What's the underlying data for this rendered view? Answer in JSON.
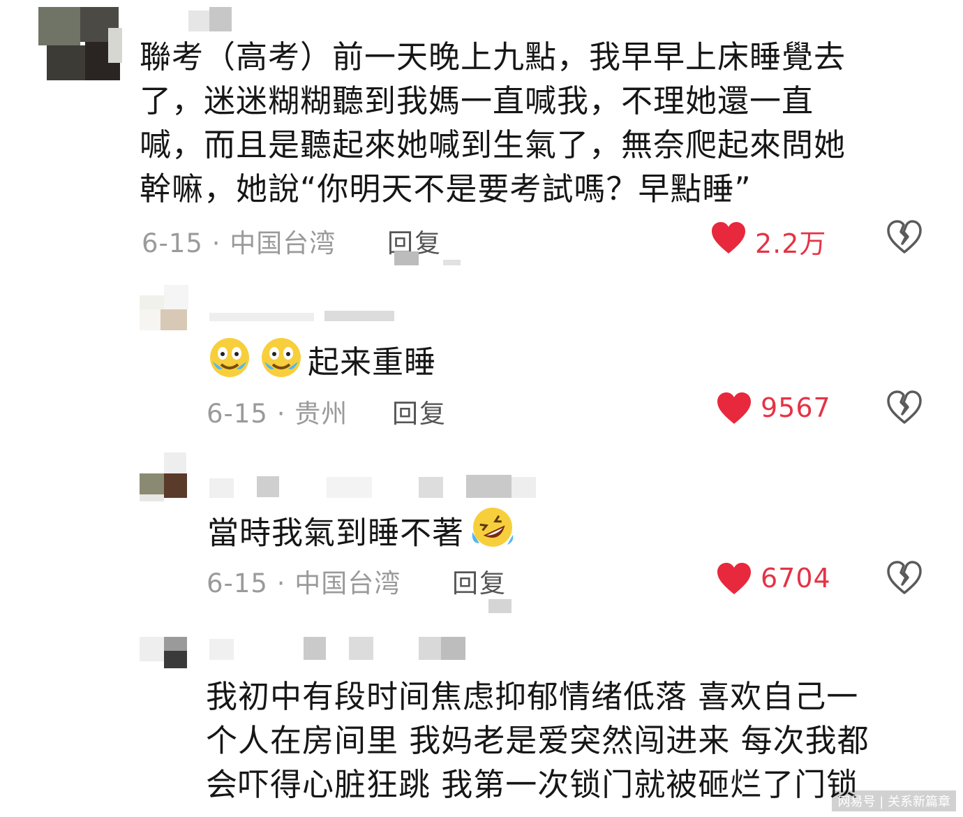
{
  "comments": [
    {
      "text_lines": [
        "聯考（高考）前一天晚上九點，我早早上床睡覺去",
        "了，迷迷糊糊聽到我媽一直喊我，不理她還一直",
        "喊，而且是聽起來她喊到生氣了，無奈爬起來問她",
        "幹嘛，她說“你明天不是要考試嗎？早點睡”"
      ],
      "meta": "6-15 · 中国台湾",
      "reply_label": "回复",
      "likes": "2.2万"
    },
    {
      "text": "起来重睡",
      "emoji": [
        "crying-laugh-emoji",
        "crying-laugh-emoji"
      ],
      "meta": "6-15 · 贵州",
      "reply_label": "回复",
      "likes": "9567"
    },
    {
      "text": "當時我氣到睡不著",
      "emoji": [
        "rolling-laugh-emoji"
      ],
      "meta": "6-15 · 中国台湾",
      "reply_label": "回复",
      "likes": "6704"
    },
    {
      "text_lines": [
        "我初中有段时间焦虑抑郁情绪低落 喜欢自己一",
        "个人在房间里 我妈老是爱突然闯进来 每次我都",
        "会吓得心脏狂跳 我第一次锁门就被砸烂了门锁"
      ]
    }
  ],
  "watermark": "网易号 | 关系新篇章",
  "colors": {
    "heart": "#e8283c",
    "likes": "#e53345",
    "meta": "#9a9a9a"
  },
  "icons": {
    "like": "heart-icon",
    "dislike": "broken-heart-icon"
  }
}
